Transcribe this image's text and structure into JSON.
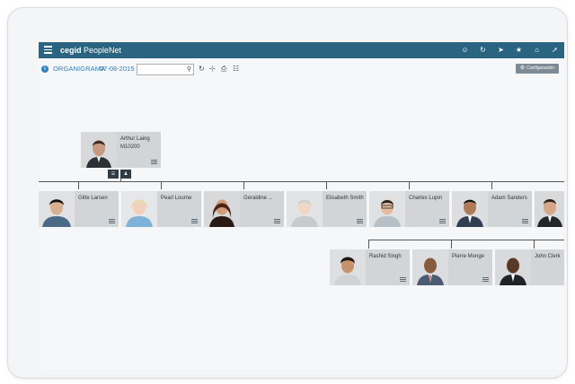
{
  "app": {
    "brand_bold": "cegid",
    "brand_rest": " PeopleNet"
  },
  "topbar_icons": [
    "users-icon",
    "share-icon",
    "pin-icon",
    "star-icon",
    "home-icon",
    "pin-alt-icon"
  ],
  "toolbar": {
    "title": "ORGANIGRAMA",
    "date": "07-08-2015",
    "search_value": "",
    "search_placeholder": "",
    "config_label": "Configuración"
  },
  "tool_icons": [
    "refresh-icon",
    "expand-icon",
    "print-icon",
    "hierarchy-icon"
  ],
  "cards": {
    "root": {
      "name": "Arthur Laing",
      "code": "M10200"
    },
    "level1": [
      {
        "name": "Gitte Larsen"
      },
      {
        "name": "Pearl Lourne"
      },
      {
        "name": "Geraldine ..."
      },
      {
        "name": "Elisabeth Smith"
      },
      {
        "name": "Charles Lupin"
      },
      {
        "name": "Adam Sanders"
      },
      {
        "name": ""
      }
    ],
    "level2": [
      {
        "name": "Rashid Singh"
      },
      {
        "name": "Pierre  Monge"
      },
      {
        "name": "John Clerk"
      }
    ]
  },
  "colors": {
    "titlebar": "#2b6481",
    "accent_text": "#2f7fc2",
    "card_info_bg": "#d2d5d8",
    "config_button_bg": "#7c8a96"
  }
}
